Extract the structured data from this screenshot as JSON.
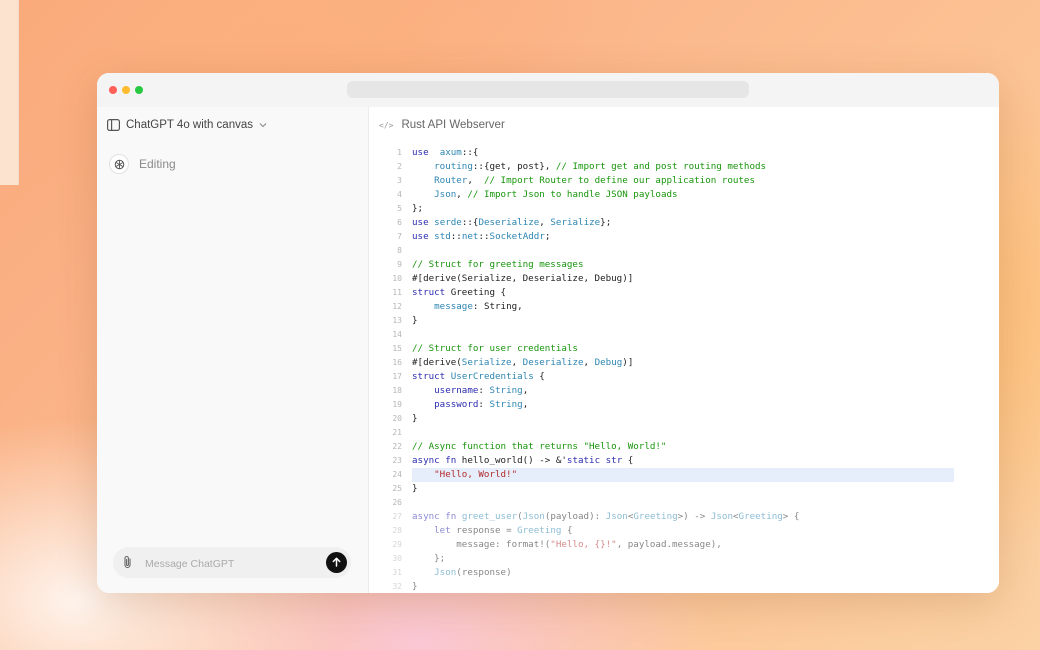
{
  "sidebar": {
    "model_label": "ChatGPT 4o with canvas",
    "editing_label": "Editing",
    "composer_placeholder": "Message ChatGPT"
  },
  "canvas": {
    "title": "Rust API Webserver",
    "highlighted_line": 24,
    "faded_from_line": 27,
    "lines": [
      {
        "n": "1",
        "segs": [
          [
            "k",
            "use"
          ],
          [
            "",
            "  "
          ],
          [
            "t",
            "axum"
          ],
          [
            "",
            "::{"
          ]
        ]
      },
      {
        "n": "2",
        "segs": [
          [
            "",
            "    "
          ],
          [
            "t",
            "routing"
          ],
          [
            "",
            "::{get, post}, "
          ],
          [
            "c",
            "// Import get and post routing methods"
          ]
        ]
      },
      {
        "n": "3",
        "segs": [
          [
            "",
            "    "
          ],
          [
            "t",
            "Router"
          ],
          [
            "",
            ",  "
          ],
          [
            "c",
            "// Import Router to define our application routes"
          ]
        ]
      },
      {
        "n": "4",
        "segs": [
          [
            "",
            "    "
          ],
          [
            "t",
            "Json"
          ],
          [
            "",
            ", "
          ],
          [
            "c",
            "// Import Json to handle JSON payloads"
          ]
        ]
      },
      {
        "n": "5",
        "segs": [
          [
            "",
            "};"
          ]
        ]
      },
      {
        "n": "6",
        "segs": [
          [
            "k",
            "use"
          ],
          [
            "",
            " "
          ],
          [
            "t",
            "serde"
          ],
          [
            "",
            "::{"
          ],
          [
            "t",
            "Deserialize"
          ],
          [
            "",
            ", "
          ],
          [
            "t",
            "Serialize"
          ],
          [
            "",
            "};"
          ]
        ]
      },
      {
        "n": "7",
        "segs": [
          [
            "k",
            "use"
          ],
          [
            "",
            " "
          ],
          [
            "t",
            "std"
          ],
          [
            "",
            "::"
          ],
          [
            "t",
            "net"
          ],
          [
            "",
            "::"
          ],
          [
            "t",
            "SocketAddr"
          ],
          [
            "",
            ";"
          ]
        ]
      },
      {
        "n": "8",
        "segs": []
      },
      {
        "n": "9",
        "segs": [
          [
            "c",
            "// Struct for greeting messages"
          ]
        ]
      },
      {
        "n": "10",
        "segs": [
          [
            "",
            "#[derive(Serialize, Deserialize, Debug)]"
          ]
        ]
      },
      {
        "n": "11",
        "segs": [
          [
            "k",
            "struct"
          ],
          [
            "",
            " Greeting {"
          ]
        ]
      },
      {
        "n": "12",
        "segs": [
          [
            "",
            "    "
          ],
          [
            "t",
            "message"
          ],
          [
            "",
            ": String,"
          ]
        ]
      },
      {
        "n": "13",
        "segs": [
          [
            "",
            "}"
          ]
        ]
      },
      {
        "n": "14",
        "segs": []
      },
      {
        "n": "15",
        "segs": [
          [
            "c",
            "// Struct for user credentials"
          ]
        ]
      },
      {
        "n": "16",
        "segs": [
          [
            "",
            "#[derive("
          ],
          [
            "t",
            "Serialize"
          ],
          [
            "",
            ", "
          ],
          [
            "t",
            "Deserialize"
          ],
          [
            "",
            ", "
          ],
          [
            "t",
            "Debug"
          ],
          [
            "",
            ")]"
          ]
        ]
      },
      {
        "n": "17",
        "segs": [
          [
            "k",
            "struct"
          ],
          [
            "",
            " "
          ],
          [
            "t",
            "UserCredentials"
          ],
          [
            "",
            " {"
          ]
        ]
      },
      {
        "n": "18",
        "segs": [
          [
            "",
            "    "
          ],
          [
            "k",
            "username"
          ],
          [
            "",
            ": "
          ],
          [
            "t",
            "String"
          ],
          [
            "",
            ","
          ]
        ]
      },
      {
        "n": "19",
        "segs": [
          [
            "",
            "    "
          ],
          [
            "k",
            "password"
          ],
          [
            "",
            ": "
          ],
          [
            "t",
            "String"
          ],
          [
            "",
            ","
          ]
        ]
      },
      {
        "n": "20",
        "segs": [
          [
            "",
            "}"
          ]
        ]
      },
      {
        "n": "21",
        "segs": []
      },
      {
        "n": "22",
        "segs": [
          [
            "c",
            "// Async function that returns \"Hello, World!\""
          ]
        ]
      },
      {
        "n": "23",
        "segs": [
          [
            "k",
            "async fn"
          ],
          [
            "",
            " hello_world() -> &'"
          ],
          [
            "k",
            "static str"
          ],
          [
            "",
            " {"
          ]
        ]
      },
      {
        "n": "24",
        "segs": [
          [
            "",
            "    "
          ],
          [
            "s",
            "\"Hello, World!\""
          ]
        ]
      },
      {
        "n": "25",
        "segs": [
          [
            "",
            "}"
          ]
        ]
      },
      {
        "n": "26",
        "segs": []
      },
      {
        "n": "27",
        "segs": [
          [
            "k",
            "async fn"
          ],
          [
            "",
            " "
          ],
          [
            "t",
            "greet_user"
          ],
          [
            "",
            "("
          ],
          [
            "t",
            "Json"
          ],
          [
            "",
            "(payload): "
          ],
          [
            "t",
            "Json"
          ],
          [
            "",
            "<"
          ],
          [
            "t",
            "Greeting"
          ],
          [
            "",
            ">) -> "
          ],
          [
            "t",
            "Json"
          ],
          [
            "",
            "<"
          ],
          [
            "t",
            "Greeting"
          ],
          [
            "",
            "> {"
          ]
        ]
      },
      {
        "n": "28",
        "segs": [
          [
            "",
            "    "
          ],
          [
            "k",
            "let"
          ],
          [
            "",
            " response = "
          ],
          [
            "t",
            "Greeting"
          ],
          [
            "",
            " {"
          ]
        ]
      },
      {
        "n": "29",
        "segs": [
          [
            "",
            "        message: format!("
          ],
          [
            "s",
            "\"Hello, {}!\""
          ],
          [
            "",
            ", payload.message),"
          ]
        ]
      },
      {
        "n": "30",
        "segs": [
          [
            "",
            "    };"
          ]
        ]
      },
      {
        "n": "31",
        "segs": [
          [
            "",
            "    "
          ],
          [
            "t",
            "Json"
          ],
          [
            "",
            "(response)"
          ]
        ]
      },
      {
        "n": "32",
        "segs": [
          [
            "",
            "}"
          ]
        ]
      }
    ]
  },
  "colors": {
    "keyword": "#2c2cb0",
    "type": "#2e86b2",
    "comment": "#18960c",
    "string": "#b22a2a",
    "traffic_red": "#ff5f57",
    "traffic_yellow": "#febc2e",
    "traffic_green": "#28c840"
  },
  "icons": {
    "sidebar_toggle": "sidebar-icon",
    "model_chevron": "chevron-down-icon",
    "editing_avatar": "openai-logo-icon",
    "composer_attach": "paperclip-icon",
    "composer_send": "arrow-up-icon",
    "canvas_type": "code-icon"
  }
}
